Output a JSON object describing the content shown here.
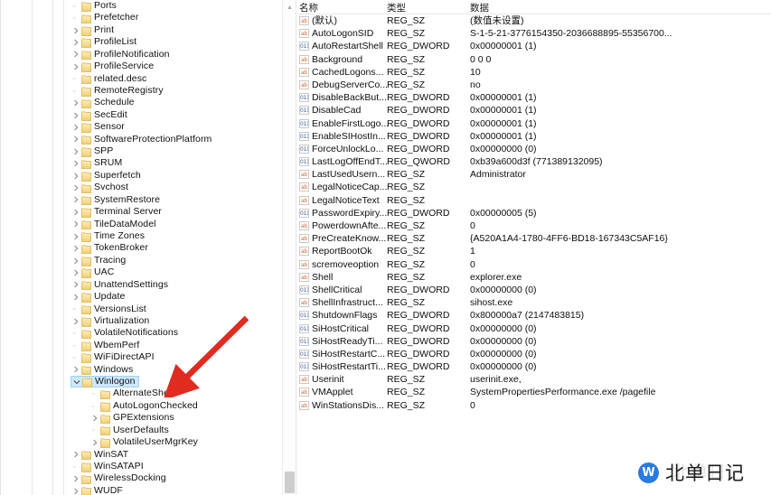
{
  "tree": {
    "scroll_up_icon": "chevron-up-icon",
    "items": [
      {
        "label": "Ports",
        "depth": 1,
        "expandable": false,
        "expanded": false,
        "selected": false
      },
      {
        "label": "Prefetcher",
        "depth": 1,
        "expandable": false,
        "expanded": false,
        "selected": false
      },
      {
        "label": "Print",
        "depth": 1,
        "expandable": true,
        "expanded": false,
        "selected": false
      },
      {
        "label": "ProfileList",
        "depth": 1,
        "expandable": true,
        "expanded": false,
        "selected": false
      },
      {
        "label": "ProfileNotification",
        "depth": 1,
        "expandable": true,
        "expanded": false,
        "selected": false
      },
      {
        "label": "ProfileService",
        "depth": 1,
        "expandable": true,
        "expanded": false,
        "selected": false
      },
      {
        "label": "related.desc",
        "depth": 1,
        "expandable": false,
        "expanded": false,
        "selected": false
      },
      {
        "label": "RemoteRegistry",
        "depth": 1,
        "expandable": false,
        "expanded": false,
        "selected": false
      },
      {
        "label": "Schedule",
        "depth": 1,
        "expandable": true,
        "expanded": false,
        "selected": false
      },
      {
        "label": "SecEdit",
        "depth": 1,
        "expandable": true,
        "expanded": false,
        "selected": false
      },
      {
        "label": "Sensor",
        "depth": 1,
        "expandable": true,
        "expanded": false,
        "selected": false
      },
      {
        "label": "SoftwareProtectionPlatform",
        "depth": 1,
        "expandable": true,
        "expanded": false,
        "selected": false
      },
      {
        "label": "SPP",
        "depth": 1,
        "expandable": true,
        "expanded": false,
        "selected": false
      },
      {
        "label": "SRUM",
        "depth": 1,
        "expandable": true,
        "expanded": false,
        "selected": false
      },
      {
        "label": "Superfetch",
        "depth": 1,
        "expandable": true,
        "expanded": false,
        "selected": false
      },
      {
        "label": "Svchost",
        "depth": 1,
        "expandable": true,
        "expanded": false,
        "selected": false
      },
      {
        "label": "SystemRestore",
        "depth": 1,
        "expandable": true,
        "expanded": false,
        "selected": false
      },
      {
        "label": "Terminal Server",
        "depth": 1,
        "expandable": true,
        "expanded": false,
        "selected": false
      },
      {
        "label": "TileDataModel",
        "depth": 1,
        "expandable": true,
        "expanded": false,
        "selected": false
      },
      {
        "label": "Time Zones",
        "depth": 1,
        "expandable": true,
        "expanded": false,
        "selected": false
      },
      {
        "label": "TokenBroker",
        "depth": 1,
        "expandable": true,
        "expanded": false,
        "selected": false
      },
      {
        "label": "Tracing",
        "depth": 1,
        "expandable": true,
        "expanded": false,
        "selected": false
      },
      {
        "label": "UAC",
        "depth": 1,
        "expandable": true,
        "expanded": false,
        "selected": false
      },
      {
        "label": "UnattendSettings",
        "depth": 1,
        "expandable": true,
        "expanded": false,
        "selected": false
      },
      {
        "label": "Update",
        "depth": 1,
        "expandable": true,
        "expanded": false,
        "selected": false
      },
      {
        "label": "VersionsList",
        "depth": 1,
        "expandable": false,
        "expanded": false,
        "selected": false
      },
      {
        "label": "Virtualization",
        "depth": 1,
        "expandable": true,
        "expanded": false,
        "selected": false
      },
      {
        "label": "VolatileNotifications",
        "depth": 1,
        "expandable": false,
        "expanded": false,
        "selected": false
      },
      {
        "label": "WbemPerf",
        "depth": 1,
        "expandable": false,
        "expanded": false,
        "selected": false
      },
      {
        "label": "WiFiDirectAPI",
        "depth": 1,
        "expandable": false,
        "expanded": false,
        "selected": false
      },
      {
        "label": "Windows",
        "depth": 1,
        "expandable": true,
        "expanded": false,
        "selected": false
      },
      {
        "label": "Winlogon",
        "depth": 1,
        "expandable": true,
        "expanded": true,
        "selected": true
      },
      {
        "label": "AlternateShells",
        "depth": 2,
        "expandable": false,
        "expanded": false,
        "selected": false
      },
      {
        "label": "AutoLogonChecked",
        "depth": 2,
        "expandable": false,
        "expanded": false,
        "selected": false
      },
      {
        "label": "GPExtensions",
        "depth": 2,
        "expandable": true,
        "expanded": false,
        "selected": false
      },
      {
        "label": "UserDefaults",
        "depth": 2,
        "expandable": false,
        "expanded": false,
        "selected": false
      },
      {
        "label": "VolatileUserMgrKey",
        "depth": 2,
        "expandable": true,
        "expanded": false,
        "selected": false
      },
      {
        "label": "WinSAT",
        "depth": 1,
        "expandable": true,
        "expanded": false,
        "selected": false
      },
      {
        "label": "WinSATAPI",
        "depth": 1,
        "expandable": false,
        "expanded": false,
        "selected": false
      },
      {
        "label": "WirelessDocking",
        "depth": 1,
        "expandable": true,
        "expanded": false,
        "selected": false
      },
      {
        "label": "WUDF",
        "depth": 1,
        "expandable": true,
        "expanded": false,
        "selected": false
      }
    ]
  },
  "list": {
    "columns": {
      "name": "名称",
      "type": "类型",
      "data": "数据"
    },
    "rows": [
      {
        "icon": "string-value-icon",
        "icon_kind": "sz",
        "icon_glyph": "ab",
        "name": "(默认)",
        "type": "REG_SZ",
        "data": "(数值未设置)"
      },
      {
        "icon": "string-value-icon",
        "icon_kind": "sz",
        "icon_glyph": "ab",
        "name": "AutoLogonSID",
        "type": "REG_SZ",
        "data": "S-1-5-21-3776154350-2036688895-55356700..."
      },
      {
        "icon": "dword-value-icon",
        "icon_kind": "dw",
        "icon_glyph": "011",
        "name": "AutoRestartShell",
        "type": "REG_DWORD",
        "data": "0x00000001 (1)"
      },
      {
        "icon": "string-value-icon",
        "icon_kind": "sz",
        "icon_glyph": "ab",
        "name": "Background",
        "type": "REG_SZ",
        "data": "0 0 0"
      },
      {
        "icon": "string-value-icon",
        "icon_kind": "sz",
        "icon_glyph": "ab",
        "name": "CachedLogons...",
        "type": "REG_SZ",
        "data": "10"
      },
      {
        "icon": "string-value-icon",
        "icon_kind": "sz",
        "icon_glyph": "ab",
        "name": "DebugServerCo...",
        "type": "REG_SZ",
        "data": "no"
      },
      {
        "icon": "dword-value-icon",
        "icon_kind": "dw",
        "icon_glyph": "011",
        "name": "DisableBackBut...",
        "type": "REG_DWORD",
        "data": "0x00000001 (1)"
      },
      {
        "icon": "dword-value-icon",
        "icon_kind": "dw",
        "icon_glyph": "011",
        "name": "DisableCad",
        "type": "REG_DWORD",
        "data": "0x00000001 (1)"
      },
      {
        "icon": "dword-value-icon",
        "icon_kind": "dw",
        "icon_glyph": "011",
        "name": "EnableFirstLogo...",
        "type": "REG_DWORD",
        "data": "0x00000001 (1)"
      },
      {
        "icon": "dword-value-icon",
        "icon_kind": "dw",
        "icon_glyph": "011",
        "name": "EnableSIHostIn...",
        "type": "REG_DWORD",
        "data": "0x00000001 (1)"
      },
      {
        "icon": "dword-value-icon",
        "icon_kind": "dw",
        "icon_glyph": "011",
        "name": "ForceUnlockLo...",
        "type": "REG_DWORD",
        "data": "0x00000000 (0)"
      },
      {
        "icon": "qword-value-icon",
        "icon_kind": "dw",
        "icon_glyph": "011",
        "name": "LastLogOffEndT...",
        "type": "REG_QWORD",
        "data": "0xb39a600d3f (771389132095)"
      },
      {
        "icon": "string-value-icon",
        "icon_kind": "sz",
        "icon_glyph": "ab",
        "name": "LastUsedUsern...",
        "type": "REG_SZ",
        "data": "Administrator"
      },
      {
        "icon": "string-value-icon",
        "icon_kind": "sz",
        "icon_glyph": "ab",
        "name": "LegalNoticeCap...",
        "type": "REG_SZ",
        "data": ""
      },
      {
        "icon": "string-value-icon",
        "icon_kind": "sz",
        "icon_glyph": "ab",
        "name": "LegalNoticeText",
        "type": "REG_SZ",
        "data": ""
      },
      {
        "icon": "dword-value-icon",
        "icon_kind": "dw",
        "icon_glyph": "011",
        "name": "PasswordExpiry...",
        "type": "REG_DWORD",
        "data": "0x00000005 (5)"
      },
      {
        "icon": "string-value-icon",
        "icon_kind": "sz",
        "icon_glyph": "ab",
        "name": "PowerdownAfte...",
        "type": "REG_SZ",
        "data": "0"
      },
      {
        "icon": "string-value-icon",
        "icon_kind": "sz",
        "icon_glyph": "ab",
        "name": "PreCreateKnow...",
        "type": "REG_SZ",
        "data": "{A520A1A4-1780-4FF6-BD18-167343C5AF16}"
      },
      {
        "icon": "string-value-icon",
        "icon_kind": "sz",
        "icon_glyph": "ab",
        "name": "ReportBootOk",
        "type": "REG_SZ",
        "data": "1"
      },
      {
        "icon": "string-value-icon",
        "icon_kind": "sz",
        "icon_glyph": "ab",
        "name": "scremoveoption",
        "type": "REG_SZ",
        "data": "0"
      },
      {
        "icon": "string-value-icon",
        "icon_kind": "sz",
        "icon_glyph": "ab",
        "name": "Shell",
        "type": "REG_SZ",
        "data": "explorer.exe"
      },
      {
        "icon": "dword-value-icon",
        "icon_kind": "dw",
        "icon_glyph": "011",
        "name": "ShellCritical",
        "type": "REG_DWORD",
        "data": "0x00000000 (0)"
      },
      {
        "icon": "string-value-icon",
        "icon_kind": "sz",
        "icon_glyph": "ab",
        "name": "ShellInfrastruct...",
        "type": "REG_SZ",
        "data": "sihost.exe"
      },
      {
        "icon": "dword-value-icon",
        "icon_kind": "dw",
        "icon_glyph": "011",
        "name": "ShutdownFlags",
        "type": "REG_DWORD",
        "data": "0x800000a7 (2147483815)"
      },
      {
        "icon": "dword-value-icon",
        "icon_kind": "dw",
        "icon_glyph": "011",
        "name": "SiHostCritical",
        "type": "REG_DWORD",
        "data": "0x00000000 (0)"
      },
      {
        "icon": "dword-value-icon",
        "icon_kind": "dw",
        "icon_glyph": "011",
        "name": "SiHostReadyTi...",
        "type": "REG_DWORD",
        "data": "0x00000000 (0)"
      },
      {
        "icon": "dword-value-icon",
        "icon_kind": "dw",
        "icon_glyph": "011",
        "name": "SiHostRestartC...",
        "type": "REG_DWORD",
        "data": "0x00000000 (0)"
      },
      {
        "icon": "dword-value-icon",
        "icon_kind": "dw",
        "icon_glyph": "011",
        "name": "SiHostRestartTi...",
        "type": "REG_DWORD",
        "data": "0x00000000 (0)"
      },
      {
        "icon": "string-value-icon",
        "icon_kind": "sz",
        "icon_glyph": "ab",
        "name": "Userinit",
        "type": "REG_SZ",
        "data": "userinit.exe,"
      },
      {
        "icon": "string-value-icon",
        "icon_kind": "sz",
        "icon_glyph": "ab",
        "name": "VMApplet",
        "type": "REG_SZ",
        "data": "SystemPropertiesPerformance.exe /pagefile"
      },
      {
        "icon": "string-value-icon",
        "icon_kind": "sz",
        "icon_glyph": "ab",
        "name": "WinStationsDis...",
        "type": "REG_SZ",
        "data": "0"
      }
    ]
  },
  "annotation": {
    "arrow_color": "#e02b20",
    "points_at": "Winlogon"
  },
  "watermark": {
    "logo_glyph": "W",
    "text": "北单日记",
    "ghost_text": "北单日记",
    "logo_color": "#2b7ae0"
  }
}
